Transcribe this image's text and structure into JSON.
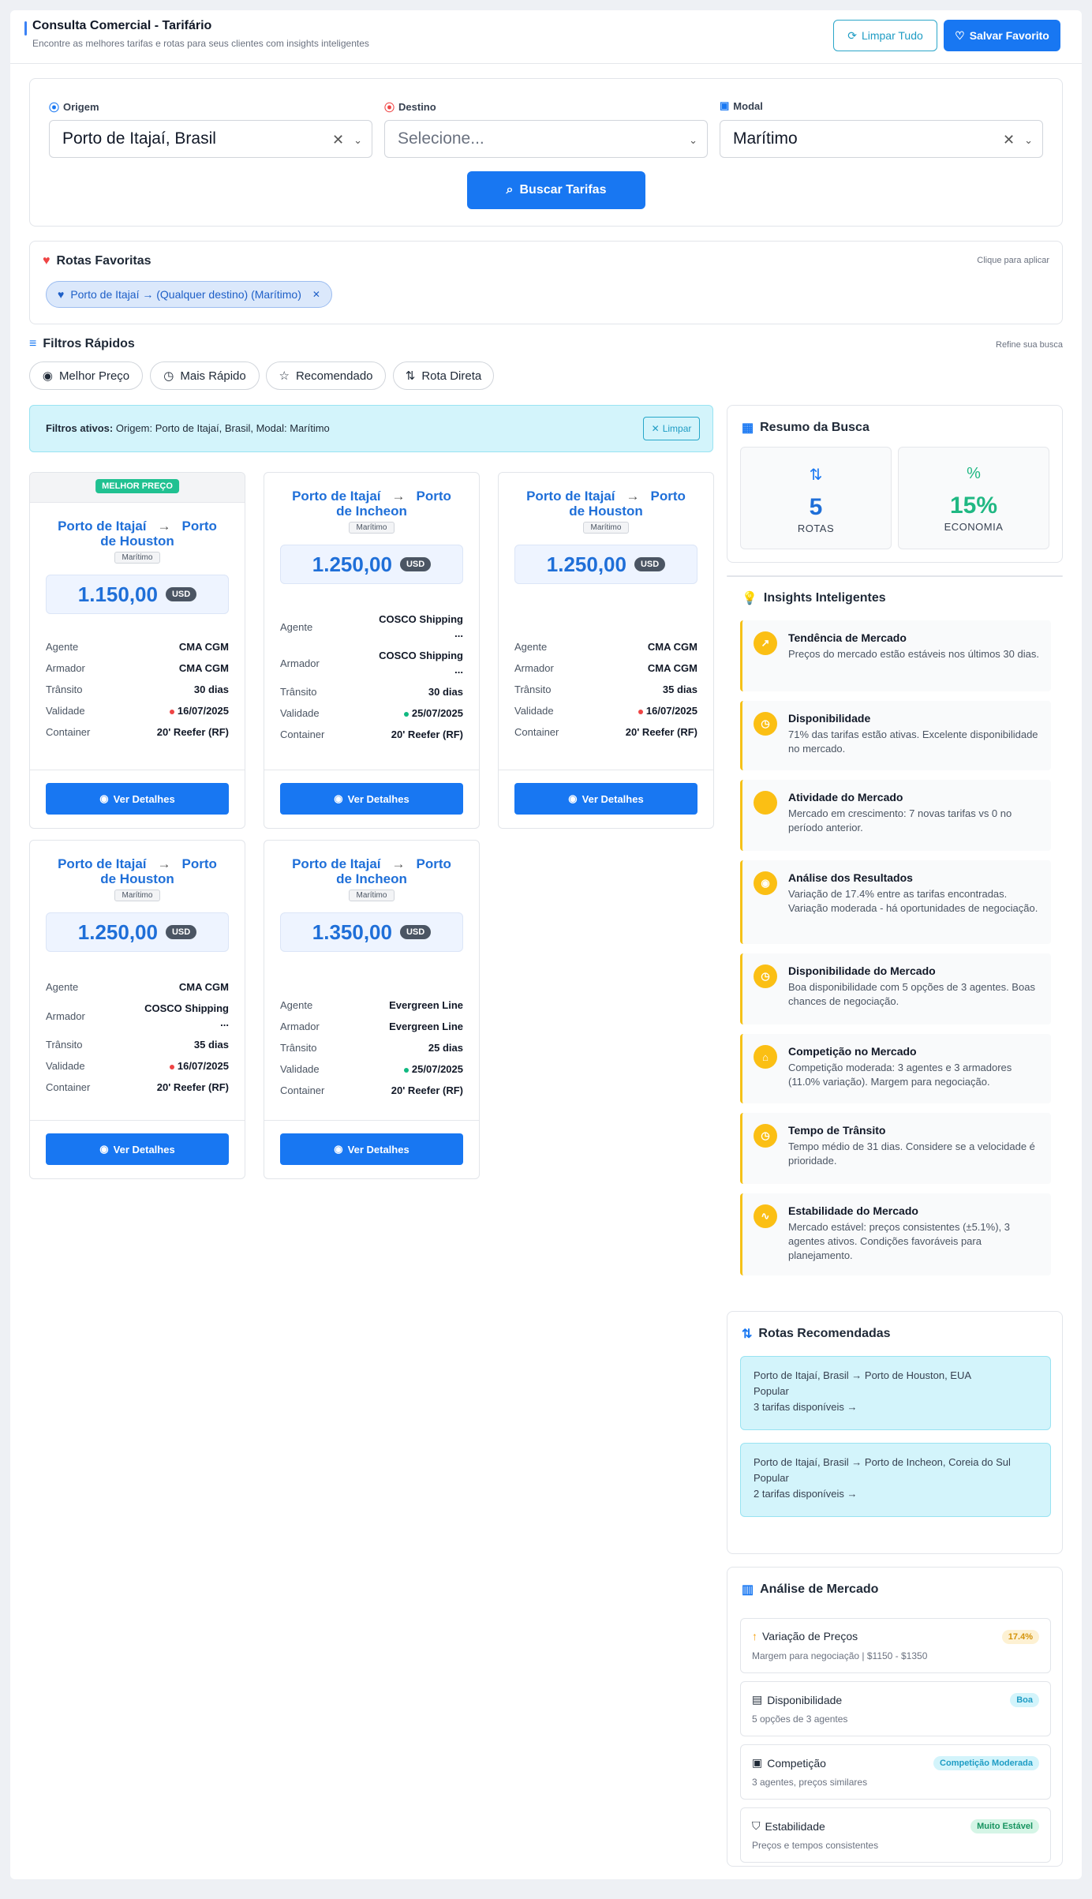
{
  "header": {
    "title": "Consulta Comercial - Tarifário",
    "subtitle": "Encontre as melhores tarifas e rotas para seus clientes com insights inteligentes",
    "clear_all": "Limpar Tudo",
    "save_favorite": "Salvar Favorito"
  },
  "search": {
    "origin_label": "Origem",
    "origin_value": "Porto de Itajaí, Brasil",
    "dest_label": "Destino",
    "dest_placeholder": "Selecione...",
    "modal_label": "Modal",
    "modal_value": "Marítimo",
    "button": "Buscar Tarifas"
  },
  "favorites": {
    "title": "Rotas Favoritas",
    "hint": "Clique para aplicar",
    "chip": "Porto de Itajaí → (Qualquer destino) (Marítimo)"
  },
  "quick_filters": {
    "title": "Filtros Rápidos",
    "hint": "Refine sua busca",
    "items": [
      "Melhor Preço",
      "Mais Rápido",
      "Recomendado",
      "Rota Direta"
    ]
  },
  "active_filters": {
    "label": "Filtros ativos:",
    "text": " Origem: Porto de Itajaí, Brasil, Modal: Marítimo",
    "clear": "Limpar"
  },
  "labels": {
    "agent": "Agente",
    "carrier": "Armador",
    "transit": "Trânsito",
    "validity": "Validade",
    "container": "Container",
    "details": "Ver Detalhes"
  },
  "tariffs": [
    {
      "badge": "MELHOR PREÇO",
      "origin": "Porto de Itajaí",
      "dest": "Porto de Houston",
      "modal": "Marítimo",
      "price": "1.150,00",
      "currency": "USD",
      "agent": "CMA CGM",
      "carrier": "CMA CGM",
      "transit": "30 dias",
      "validity": "16/07/2025",
      "validity_color": "#ef4444",
      "container": "20' Reefer (RF)"
    },
    {
      "origin": "Porto de Itajaí",
      "dest": "Porto de Incheon",
      "modal": "Marítimo",
      "price": "1.250,00",
      "currency": "USD",
      "agent": "COSCO Shipping ...",
      "carrier": "COSCO Shipping ...",
      "transit": "30 dias",
      "validity": "25/07/2025",
      "validity_color": "#10b981",
      "container": "20' Reefer (RF)"
    },
    {
      "origin": "Porto de Itajaí",
      "dest": "Porto de Houston",
      "modal": "Marítimo",
      "price": "1.250,00",
      "currency": "USD",
      "agent": "CMA CGM",
      "carrier": "CMA CGM",
      "transit": "35 dias",
      "validity": "16/07/2025",
      "validity_color": "#ef4444",
      "container": "20' Reefer (RF)"
    },
    {
      "origin": "Porto de Itajaí",
      "dest": "Porto de Houston",
      "modal": "Marítimo",
      "price": "1.250,00",
      "currency": "USD",
      "agent": "CMA CGM",
      "carrier": "COSCO Shipping ...",
      "transit": "35 dias",
      "validity": "16/07/2025",
      "validity_color": "#ef4444",
      "container": "20' Reefer (RF)"
    },
    {
      "origin": "Porto de Itajaí",
      "dest": "Porto de Incheon",
      "modal": "Marítimo",
      "price": "1.350,00",
      "currency": "USD",
      "agent": "Evergreen Line",
      "carrier": "Evergreen Line",
      "transit": "25 dias",
      "validity": "25/07/2025",
      "validity_color": "#10b981",
      "container": "20' Reefer (RF)"
    }
  ],
  "summary": {
    "title": "Resumo da Busca",
    "routes_value": "5",
    "routes_label": "ROTAS",
    "savings_value": "15%",
    "savings_label": "ECONOMIA"
  },
  "insights": {
    "title": "Insights Inteligentes",
    "items": [
      {
        "title": "Tendência de Mercado",
        "text": "Preços do mercado estão estáveis nos últimos 30 dias."
      },
      {
        "title": "Disponibilidade",
        "text": "71% das tarifas estão ativas. Excelente disponibilidade no mercado."
      },
      {
        "title": "Atividade do Mercado",
        "text": "Mercado em crescimento: 7 novas tarifas vs 0 no período anterior."
      },
      {
        "title": "Análise dos Resultados",
        "text": "Variação de 17.4% entre as tarifas encontradas. Variação moderada - há oportunidades de negociação."
      },
      {
        "title": "Disponibilidade do Mercado",
        "text": "Boa disponibilidade com 5 opções de 3 agentes. Boas chances de negociação."
      },
      {
        "title": "Competição no Mercado",
        "text": "Competição moderada: 3 agentes e 3 armadores (11.0% variação). Margem para negociação."
      },
      {
        "title": "Tempo de Trânsito",
        "text": "Tempo médio de 31 dias. Considere se a velocidade é prioridade."
      },
      {
        "title": "Estabilidade do Mercado",
        "text": "Mercado estável: preços consistentes (±5.1%), 3 agentes ativos. Condições favoráveis para planejamento."
      }
    ]
  },
  "recommended": {
    "title": "Rotas Recomendadas",
    "items": [
      {
        "route": "Porto de Itajaí, Brasil → Porto de Houston, EUA",
        "tag": "Popular",
        "count": "3 tarifas disponíveis →"
      },
      {
        "route": "Porto de Itajaí, Brasil → Porto de Incheon, Coreia do Sul",
        "tag": "Popular",
        "count": "2 tarifas disponíveis →"
      }
    ]
  },
  "market": {
    "title": "Análise de Mercado",
    "items": [
      {
        "title": "Variação de Preços",
        "text": "Margem para negociação | $1150 - $1350",
        "badge": "17.4%",
        "badge_bg": "#fdf1d3",
        "badge_fg": "#d4930a"
      },
      {
        "title": "Disponibilidade",
        "text": "5 opções de 3 agentes",
        "badge": "Boa",
        "badge_bg": "#d3f4fb",
        "badge_fg": "#1e9cc4"
      },
      {
        "title": "Competição",
        "text": "3 agentes, preços similares",
        "badge": "Competição Moderada",
        "badge_bg": "#d3f4fb",
        "badge_fg": "#1e9cc4"
      },
      {
        "title": "Estabilidade",
        "text": "Preços e tempos consistentes",
        "badge": "Muito Estável",
        "badge_bg": "#d5f5e6",
        "badge_fg": "#17935f"
      }
    ]
  }
}
